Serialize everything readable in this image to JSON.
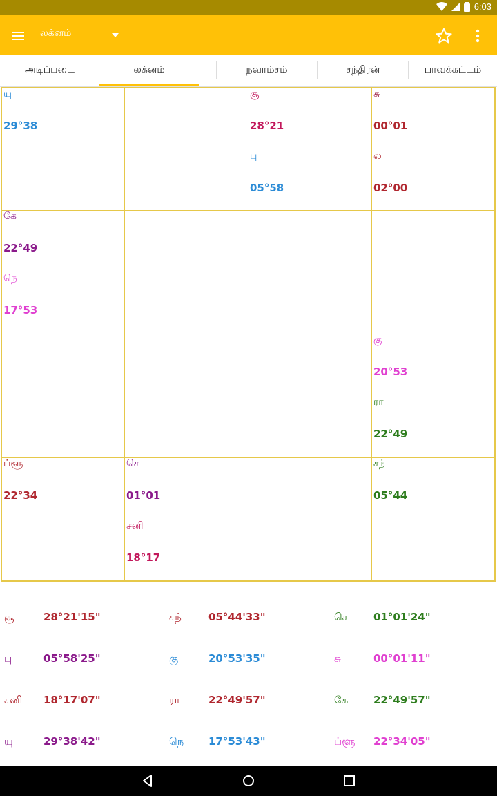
{
  "status": {
    "time": "6:03"
  },
  "appbar": {
    "title": "லக்னம்",
    "icons": [
      "menu-icon",
      "dropdown-caret-icon",
      "star-icon",
      "more-vert-icon"
    ]
  },
  "tabs": [
    {
      "label": "அடிப்படை"
    },
    {
      "label": "லக்னம்"
    },
    {
      "label": "நவாம்சம்"
    },
    {
      "label": "சந்திரன்"
    },
    {
      "label": "பாவக்கட்டம்"
    }
  ],
  "colors": {
    "appbar": "#ffc107",
    "statusbar": "#a68a00",
    "grid": "#e6c84a",
    "blue": "#2b8bd6",
    "crimson": "#c2185b",
    "darkred": "#b0272f",
    "magenta": "#e040d0",
    "purple": "#8b1a8b",
    "green": "#2e7d1e",
    "wine": "#a0284a"
  },
  "chart": {
    "cells": {
      "c00": [
        {
          "t": "யு",
          "c": "blue",
          "k": "name"
        },
        {
          "t": "29°38",
          "c": "blue",
          "k": "deg"
        }
      ],
      "c02": [
        {
          "t": "சூ",
          "c": "crimson",
          "k": "name"
        },
        {
          "t": "28°21",
          "c": "crimson",
          "k": "deg"
        },
        {
          "t": "பு",
          "c": "blue",
          "k": "name"
        },
        {
          "t": "05°58",
          "c": "blue",
          "k": "deg"
        }
      ],
      "c03": [
        {
          "t": "சு",
          "c": "wine",
          "k": "name"
        },
        {
          "t": "00°01",
          "c": "darkred",
          "k": "deg"
        },
        {
          "t": "ல",
          "c": "darkred",
          "k": "name"
        },
        {
          "t": "02°00",
          "c": "darkred",
          "k": "deg"
        }
      ],
      "c10": [
        {
          "t": "கே",
          "c": "purple",
          "k": "name"
        },
        {
          "t": "22°49",
          "c": "purple",
          "k": "deg"
        },
        {
          "t": "நெ",
          "c": "magenta",
          "k": "name"
        },
        {
          "t": "17°53",
          "c": "magenta",
          "k": "deg"
        }
      ],
      "c23": [
        {
          "t": "கு",
          "c": "magenta",
          "k": "name"
        },
        {
          "t": "20°53",
          "c": "magenta",
          "k": "deg"
        },
        {
          "t": "ரா",
          "c": "green",
          "k": "name"
        },
        {
          "t": "22°49",
          "c": "green",
          "k": "deg"
        }
      ],
      "c30": [
        {
          "t": "ப்ளூ",
          "c": "darkred",
          "k": "name"
        },
        {
          "t": "22°34",
          "c": "darkred",
          "k": "deg"
        }
      ],
      "c31": [
        {
          "t": "செ",
          "c": "purple",
          "k": "name"
        },
        {
          "t": "01°01",
          "c": "purple",
          "k": "deg"
        },
        {
          "t": "சனி",
          "c": "crimson",
          "k": "name"
        },
        {
          "t": "18°17",
          "c": "crimson",
          "k": "deg"
        }
      ],
      "c33": [
        {
          "t": "சந்",
          "c": "green",
          "k": "name"
        },
        {
          "t": "05°44",
          "c": "green",
          "k": "deg"
        }
      ]
    }
  },
  "positions": [
    [
      {
        "p": "சூ",
        "d": "28°21'15\"",
        "c": "darkred"
      },
      {
        "p": "சந்",
        "d": "05°44'33\"",
        "c": "darkred"
      },
      {
        "p": "செ",
        "d": "01°01'24\"",
        "c": "green"
      }
    ],
    [
      {
        "p": "பு",
        "d": "05°58'25\"",
        "c": "purple"
      },
      {
        "p": "கு",
        "d": "20°53'35\"",
        "c": "blue"
      },
      {
        "p": "சு",
        "d": "00°01'11\"",
        "c": "magenta"
      }
    ],
    [
      {
        "p": "சனி",
        "d": "18°17'07\"",
        "c": "darkred"
      },
      {
        "p": "ரா",
        "d": "22°49'57\"",
        "c": "darkred"
      },
      {
        "p": "கே",
        "d": "22°49'57\"",
        "c": "green"
      }
    ],
    [
      {
        "p": "யு",
        "d": "29°38'42\"",
        "c": "purple"
      },
      {
        "p": "நெ",
        "d": "17°53'43\"",
        "c": "blue"
      },
      {
        "p": "ப்ளூ",
        "d": "22°34'05\"",
        "c": "magenta"
      }
    ]
  ]
}
